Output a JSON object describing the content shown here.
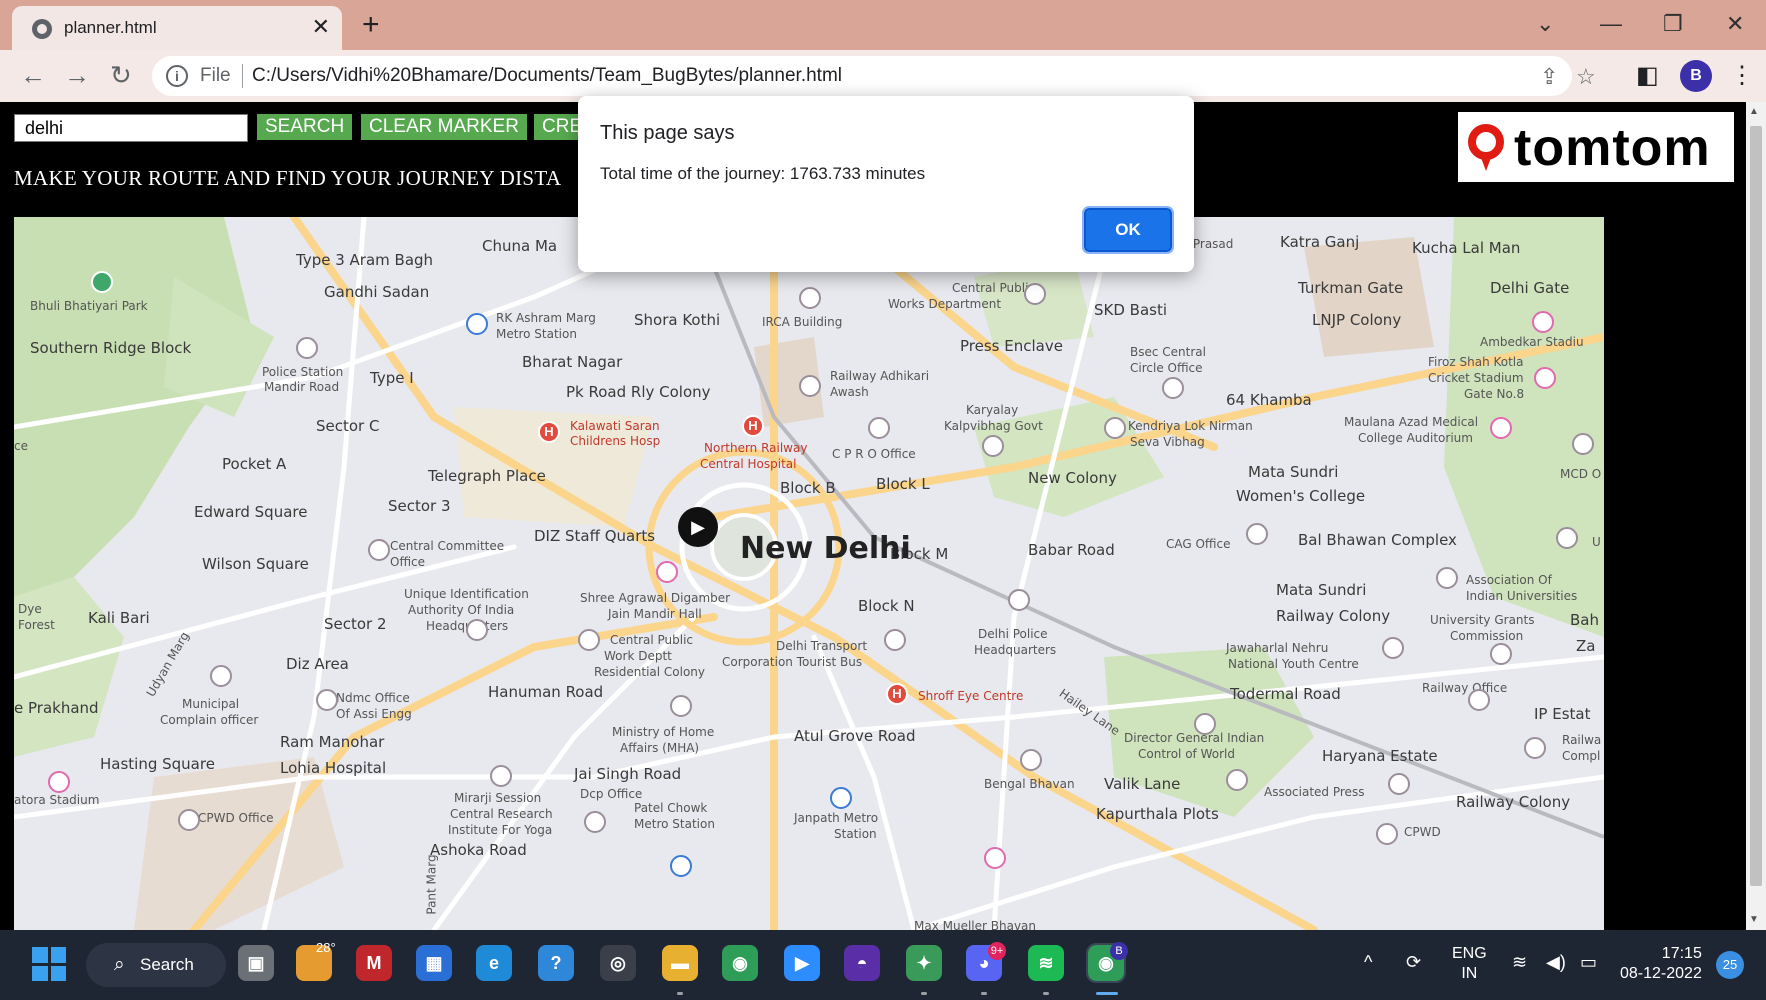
{
  "browser": {
    "tab_title": "planner.html",
    "tab_close": "✕",
    "new_tab": "+",
    "file_label": "File",
    "url": "C:/Users/Vidhi%20Bhamare/Documents/Team_BugBytes/planner.html",
    "profile_initial": "B"
  },
  "page": {
    "search_value": "delhi",
    "buttons": {
      "search": "SEARCH",
      "clear_marker": "CLEAR MARKER",
      "create": "CRE"
    },
    "headline": "MAKE YOUR ROUTE AND FIND YOUR JOURNEY DISTA",
    "logo_text": "tomtom"
  },
  "dialog": {
    "title": "This page says",
    "message": "Total time of the journey: 1763.733 minutes",
    "ok": "OK"
  },
  "map": {
    "city": "New Delhi",
    "labels_large": [
      "Type 3 Aram Bagh",
      "Gandhi Sadan",
      "Chuna Ma",
      "Shora Kothi",
      "Bharat Nagar",
      "Pk Road Rly Colony",
      "Southern Ridge Block",
      "Type I",
      "Sector C",
      "Pocket A",
      "Telegraph Place",
      "Sector 3",
      "Edward Square",
      "Wilson Square",
      "DIZ Staff Quarts",
      "Block B",
      "Block L",
      "Block M",
      "Block N",
      "Press Enclave",
      "SKD Basti",
      "Katra Ganj",
      "Kucha Lal Man",
      "Turkman Gate",
      "Delhi Gate",
      "LNJP Colony",
      "64 Khamba",
      "New Colony",
      "Mata Sundri",
      "Women's College",
      "Babar Road",
      "Bal Bhawan Complex",
      "Mata Sundri",
      "Railway Colony",
      "Kali Bari",
      "Sector 2",
      "Diz Area",
      "Hanuman Road",
      "e Prakhand",
      "Ram Manohar",
      "Lohia Hospital",
      "Hasting Square",
      "Jai Singh Road",
      "Atul Grove Road",
      "Todermal Road",
      "Haryana Estate",
      "Valik Lane",
      "Kapurthala Plots",
      "Railway Colony",
      "IP Estat",
      "Ashoka Road",
      "Bah",
      "Za"
    ],
    "labels_small": [
      "Bhuli Bhatiyari Park",
      "Police Station",
      "Mandir Road",
      "RK Ashram Marg",
      "Metro Station",
      "IRCA Building",
      "Central Public",
      "Works Department",
      "Railway Adhikari",
      "Awash",
      "Karyalay",
      "Kalpvibhag Govt",
      "Kendriya Lok Nirman",
      "Seva Vibhag",
      "Bsec Central",
      "Circle Office",
      "C P R O Office",
      "Ambedkar Stadiu",
      "Firoz Shah Kotla",
      "Cricket Stadium",
      "Gate No.8",
      "Maulana Azad Medical",
      "College Auditorium",
      "MCD O",
      "ma Prasad",
      "Central Committee",
      "Office",
      "Unique Identification",
      "Authority Of India",
      "Headquarters",
      "Shree Agrawal Digamber",
      "Jain Mandir Hall",
      "Central Public",
      "Work Deptt",
      "Residential Colony",
      "Delhi Transport",
      "Corporation Tourist Bus",
      "Delhi Police",
      "Headquarters",
      "CAG Office",
      "Association Of",
      "Indian Universities",
      "University Grants",
      "Commission",
      "Jawaharlal Nehru",
      "National Youth Centre",
      "Railway Office",
      "Municipal",
      "Complain officer",
      "Ndmc Office",
      "Of Assi Engg",
      "Ministry of Home",
      "Affairs (MHA)",
      "Hailey Lane",
      "Director General Indian",
      "Control of World",
      "Bengal Bhavan",
      "Associated Press",
      "Dye",
      "Forest",
      "atora Stadium",
      "CPWD Office",
      "Mirarji Session",
      "Central Research",
      "Institute For Yoga",
      "Dcp Office",
      "Patel Chowk",
      "Metro Station",
      "Janpath Metro",
      "Station",
      "CPWD",
      "Max Mueller Bhavan",
      "Udyan Marg",
      "Pant Marg",
      "ce",
      "U",
      "Railwa",
      "Compl"
    ],
    "hospital_labels": [
      "Kalawati Saran",
      "Childrens Hosp",
      "Northern Railway",
      "Central Hospital",
      "Shroff Eye Centre"
    ]
  },
  "taskbar": {
    "search_label": "Search",
    "weather": "28°",
    "lang_line1": "ENG",
    "lang_line2": "IN",
    "time": "17:15",
    "date": "08-12-2022",
    "notifications": "25",
    "badge_discord": "9+",
    "profile_badge": "B"
  }
}
